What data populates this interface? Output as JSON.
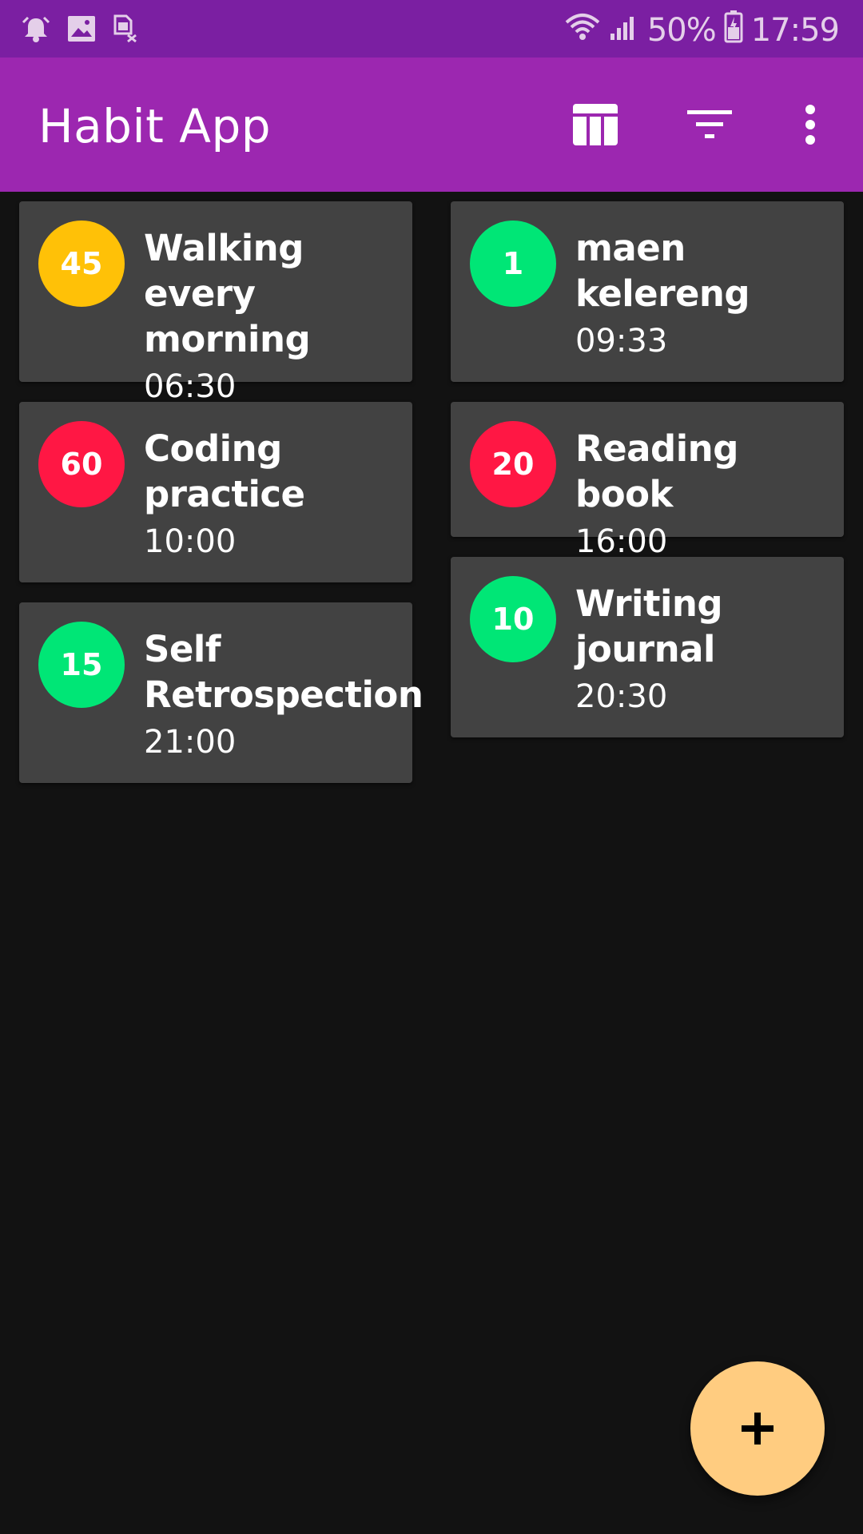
{
  "status_bar": {
    "icons_left": [
      "alarm-icon",
      "image-icon",
      "sim-card-off-icon"
    ],
    "icons_right": [
      "wifi-icon",
      "signal-icon",
      "battery-icon"
    ],
    "battery": "50%",
    "time": "17:59"
  },
  "app_bar": {
    "title": "Habit App",
    "actions": [
      "view-columns-icon",
      "filter-icon",
      "more-vert-icon"
    ]
  },
  "colors": {
    "status_bar": "#7b1fa2",
    "app_bar": "#9c27b0",
    "background": "#121212",
    "card": "#424242",
    "fab": "#ffcc80"
  },
  "habits": [
    {
      "count": "45",
      "title": "Walking every morning",
      "time": "06:30",
      "color": "#ffc107"
    },
    {
      "count": "1",
      "title": "maen kelereng",
      "time": "09:33",
      "color": "#00e676"
    },
    {
      "count": "60",
      "title": "Coding practice",
      "time": "10:00",
      "color": "#ff1744"
    },
    {
      "count": "20",
      "title": "Reading book",
      "time": "16:00",
      "color": "#ff1744"
    },
    {
      "count": "15",
      "title": "Self Retrospection",
      "time": "21:00",
      "color": "#00e676"
    },
    {
      "count": "10",
      "title": "Writing journal",
      "time": "20:30",
      "color": "#00e676"
    }
  ],
  "fab": {
    "icon": "plus-icon"
  }
}
